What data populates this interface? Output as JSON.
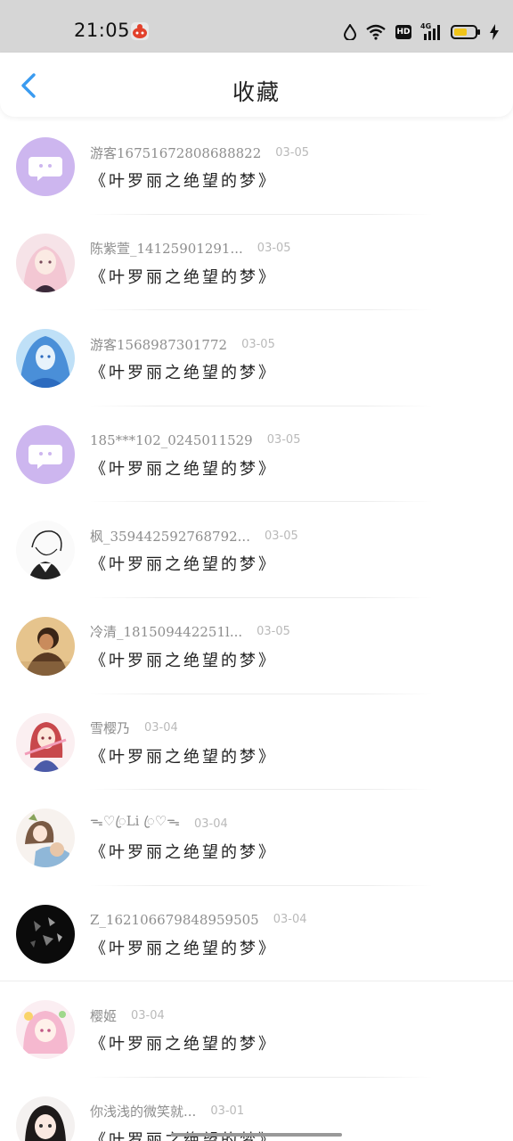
{
  "status_bar": {
    "time": "21:05",
    "icons": [
      "app-notification-icon",
      "water-drop-icon",
      "wifi-icon",
      "hd-icon",
      "4g-signal-icon",
      "battery-icon",
      "charging-icon"
    ],
    "hd_label": "HD",
    "network_label": "4G"
  },
  "header": {
    "back_icon": "chevron-left-icon",
    "title": "收藏"
  },
  "colors": {
    "accent": "#3a9bf0",
    "status_bar_bg": "#d6d6d6",
    "default_avatar_bg": "#cdb6ef"
  },
  "favorites": [
    {
      "username": "游客16751672808688822",
      "date": "03-05",
      "work": "《叶罗丽之绝望的梦》",
      "avatar": "default-chat-avatar"
    },
    {
      "username": "陈紫萱_14125901291...",
      "date": "03-05",
      "work": "《叶罗丽之绝望的梦》",
      "avatar": "anime-girl-pink-avatar"
    },
    {
      "username": "游客1568987301772",
      "date": "03-05",
      "work": "《叶罗丽之绝望的梦》",
      "avatar": "anime-girl-blue-avatar"
    },
    {
      "username": "185***102_0245011529",
      "date": "03-05",
      "work": "《叶罗丽之绝望的梦》",
      "avatar": "default-chat-avatar"
    },
    {
      "username": "枫_359442592768792...",
      "date": "03-05",
      "work": "《叶罗丽之绝望的梦》",
      "avatar": "sketch-boy-avatar"
    },
    {
      "username": "冷清_181509442251l...",
      "date": "03-05",
      "work": "《叶罗丽之绝望的梦》",
      "avatar": "photo-person-avatar"
    },
    {
      "username": "雪樱乃",
      "date": "03-04",
      "work": "《叶罗丽之绝望的梦》",
      "avatar": "anime-girl-red-avatar"
    },
    {
      "username": "ᯓ♡ꦿLi ꦿ♡ᯓ",
      "date": "03-04",
      "work": "《叶罗丽之绝望的梦》",
      "avatar": "anime-couple-avatar"
    },
    {
      "username": "Z_162106679848959505",
      "date": "03-04",
      "work": "《叶罗丽之绝望的梦》",
      "avatar": "dark-shards-avatar"
    },
    {
      "username": "樱姬",
      "date": "03-04",
      "work": "《叶罗丽之绝望的梦》",
      "avatar": "anime-girl-pastel-avatar"
    },
    {
      "username": "你浅浅的微笑就...",
      "date": "03-01",
      "work": "《叶罗丽之绝望的梦》",
      "avatar": "anime-girl-dark-hair-avatar"
    }
  ]
}
